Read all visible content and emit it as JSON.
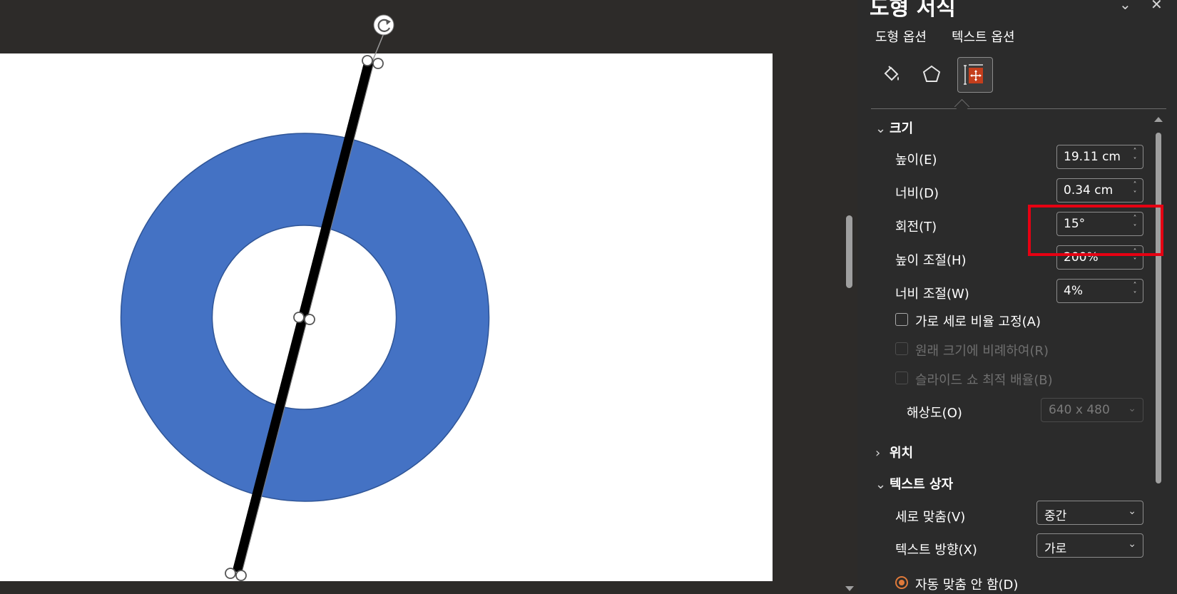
{
  "pane": {
    "title": "도형 서식",
    "tabs": [
      "도형 옵션",
      "텍스트 옵션"
    ],
    "category_icons": [
      "fill-bucket-icon",
      "pentagon-icon",
      "size-properties-icon"
    ]
  },
  "size_section": {
    "header": "크기",
    "height_label": "높이(E)",
    "height_value": "19.11 cm",
    "width_label": "너비(D)",
    "width_value": "0.34 cm",
    "rotation_label": "회전(T)",
    "rotation_value": "15°",
    "scale_height_label": "높이 조절(H)",
    "scale_height_value": "200%",
    "scale_width_label": "너비 조절(W)",
    "scale_width_value": "4%",
    "lock_aspect_label": "가로 세로 비율 고정(A)",
    "relative_original_label": "원래 크기에 비례하여(R)",
    "best_scale_label": "슬라이드 쇼 최적 배율(B)",
    "resolution_label": "해상도(O)",
    "resolution_value": "640 x 480"
  },
  "position_section": {
    "header": "위치"
  },
  "textbox_section": {
    "header": "텍스트 상자",
    "vertical_align_label": "세로 맞춤(V)",
    "vertical_align_value": "중간",
    "text_direction_label": "텍스트 방향(X)",
    "text_direction_value": "가로",
    "autofit_label": "자동 맞춤 안 함(D)"
  },
  "colors": {
    "donut_fill": "#4472c4",
    "donut_stroke": "#2f5597",
    "highlight": "#e60012",
    "radio_accent": "#e07a3a",
    "active_icon": "#c43e1c"
  }
}
